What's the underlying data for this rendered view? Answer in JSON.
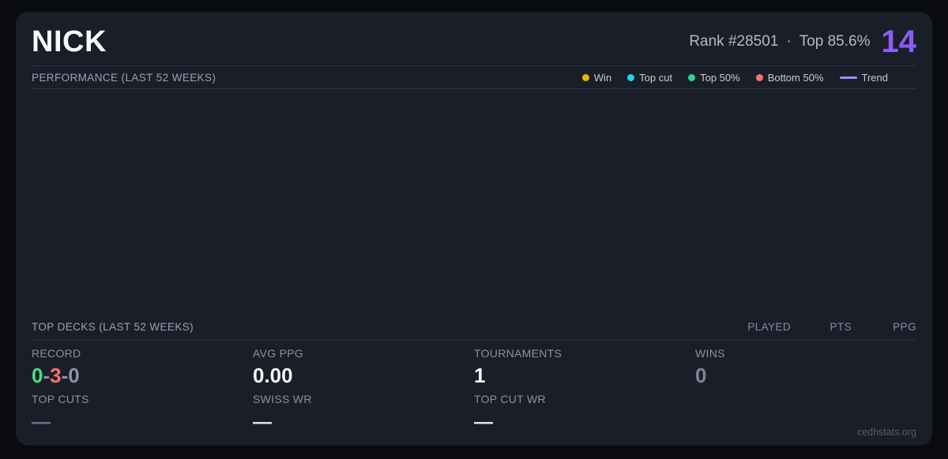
{
  "header": {
    "player_name": "NICK",
    "rank_text": "Rank #28501",
    "separator": "·",
    "top_percent_text": "Top 85.6%",
    "score": "14"
  },
  "performance": {
    "title": "PERFORMANCE (LAST 52 WEEKS)",
    "legend": [
      {
        "label": "Win",
        "color": "#eab308",
        "marker": "dot"
      },
      {
        "label": "Top cut",
        "color": "#22d3ee",
        "marker": "dot"
      },
      {
        "label": "Top 50%",
        "color": "#34d399",
        "marker": "dot"
      },
      {
        "label": "Bottom 50%",
        "color": "#f87171",
        "marker": "dot"
      },
      {
        "label": "Trend",
        "color": "#a78bfa",
        "marker": "line"
      }
    ],
    "chart_points": []
  },
  "top_decks": {
    "title": "TOP DECKS (LAST 52 WEEKS)",
    "columns": [
      "PLAYED",
      "PTS",
      "PPG"
    ],
    "rows": []
  },
  "stats": {
    "record": {
      "label": "RECORD",
      "wins": "0",
      "losses": "3",
      "draws": "0",
      "separator": "-",
      "sub_label": "TOP CUTS",
      "sub_value": "—"
    },
    "avg_ppg": {
      "label": "AVG PPG",
      "value": "0.00",
      "sub_label": "SWISS WR",
      "sub_value": "—"
    },
    "tournaments": {
      "label": "TOURNAMENTS",
      "value": "1",
      "sub_label": "TOP CUT WR",
      "sub_value": "—"
    },
    "wins": {
      "label": "WINS",
      "value": "0"
    }
  },
  "footer": {
    "watermark": "cedhstats.org"
  },
  "colors": {
    "page_background": "#0a0b0f",
    "card_background": "#1a1e29",
    "border": "#2d3342",
    "accent_purple": "#8b5cf6",
    "win_yellow": "#eab308",
    "top_cut_cyan": "#22d3ee",
    "top50_green": "#34d399",
    "bottom50_red": "#f87171",
    "trend_purple": "#a78bfa",
    "record_win_green": "#4ade80",
    "record_loss_red": "#f87171"
  }
}
